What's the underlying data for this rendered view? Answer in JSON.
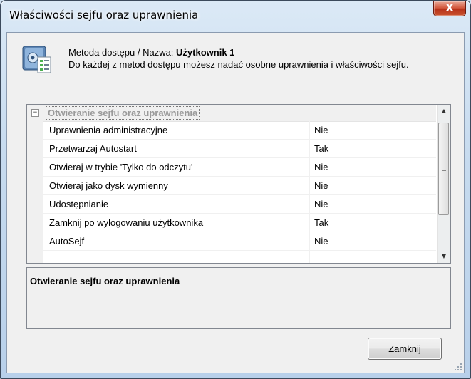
{
  "window": {
    "title": "Właściwości sejfu oraz uprawnienia",
    "close_glyph": "X"
  },
  "header": {
    "label_prefix": "Metoda dostępu / Nazwa:",
    "access_name": "Użytkownik 1",
    "description": "Do każdej z metod dostępu możesz nadać osobne uprawnienia i właściwości sejfu.",
    "icon": "safe-properties-icon"
  },
  "property_grid": {
    "category": {
      "label": "Otwieranie sejfu oraz uprawnienia",
      "toggle_glyph": "−"
    },
    "properties": [
      {
        "name": "Uprawnienia administracyjne",
        "value": "Nie"
      },
      {
        "name": "Przetwarzaj Autostart",
        "value": "Tak"
      },
      {
        "name": "Otwieraj w trybie 'Tylko do odczytu'",
        "value": "Nie"
      },
      {
        "name": "Otwieraj jako dysk wymienny",
        "value": "Nie"
      },
      {
        "name": "Udostępnianie",
        "value": "Nie"
      },
      {
        "name": "Zamknij po wylogowaniu użytkownika",
        "value": "Tak"
      },
      {
        "name": "AutoSejf",
        "value": "Nie"
      },
      {
        "name": "",
        "value": ""
      }
    ],
    "scroll": {
      "up_glyph": "▲",
      "down_glyph": "▼"
    }
  },
  "description_panel": {
    "title": "Otwieranie sejfu oraz uprawnienia"
  },
  "footer": {
    "close_label": "Zamknij"
  },
  "colors": {
    "title_bar": "#c7dbef",
    "close_button": "#c9542f",
    "client_bg": "#f0f0f0"
  }
}
